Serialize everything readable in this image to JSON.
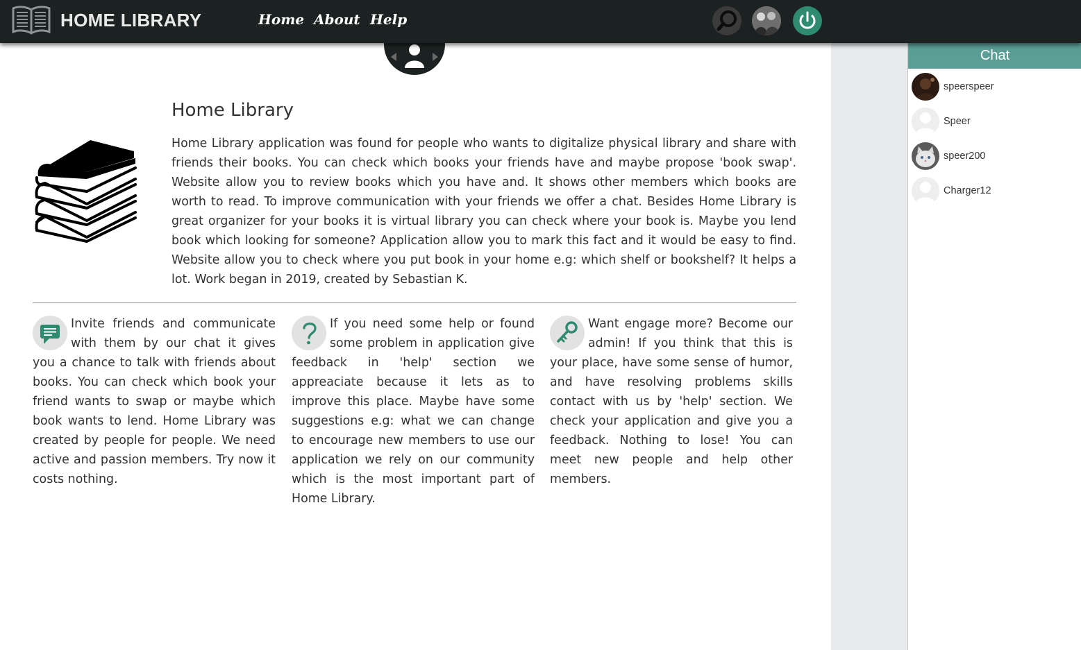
{
  "navbar": {
    "brand": "HOME LIBRARY",
    "links": [
      "Home",
      "About",
      "Help"
    ],
    "icons": [
      "book-icon",
      "search-icon",
      "user-avatar",
      "power-icon"
    ]
  },
  "main": {
    "title": "Home Library",
    "intro": "Home Library application was found for people who wants to digitalize physical library and share with friends their books. You can check which books your friends have and maybe propose 'book swap'. Website allow you to review books which you have and. It shows other members which books are worth to read. To improve communication with your friends we offer a chat. Besides Home Library is great organizer for your books it is virtual library you can check where your book is. Maybe you lend book which looking for someone? Application allow you to mark this fact and it would be easy to find. Website allow you to check where you put book in your home e.g: which shelf or bookshelf? It helps a lot. Work began in 2019, created by Sebastian K.",
    "features": [
      {
        "icon": "chat-icon",
        "text": "Invite friends and communicate with them by our chat it gives you a chance to talk with friends about books. You can check which book your friend wants to swap or maybe which book wants to lend. Home Library was created by people for people. We need active and passion members. Try now it costs nothing."
      },
      {
        "icon": "question-icon",
        "text": "If you need some help or found some problem in application give feedback in 'help' section we appreaciate because it lets as to improve this place. Maybe have some suggestions e.g: what we can change to encourage new members to use our application we rely on our community which is the most important part of Home Library."
      },
      {
        "icon": "key-icon",
        "text": "Want engage more? Become our admin! If you think that this is your place, have some sense of humor, and have resolving problems skills contact with us by 'help' section. We check your application and give you a feedback. Nothing to lose! You can meet new people and help other members."
      }
    ]
  },
  "chat": {
    "title": "Chat",
    "users": [
      {
        "name": "speerspeer",
        "avatar": "dark-photo"
      },
      {
        "name": "Speer",
        "avatar": "default-avatar"
      },
      {
        "name": "speer200",
        "avatar": "cat-photo"
      },
      {
        "name": "Charger12",
        "avatar": "default-avatar"
      }
    ]
  },
  "colors": {
    "navbar": "#1b2221",
    "accent": "#2e8b6f",
    "chat_header": "#5a9e96",
    "side_gap": "#e8eaed"
  }
}
